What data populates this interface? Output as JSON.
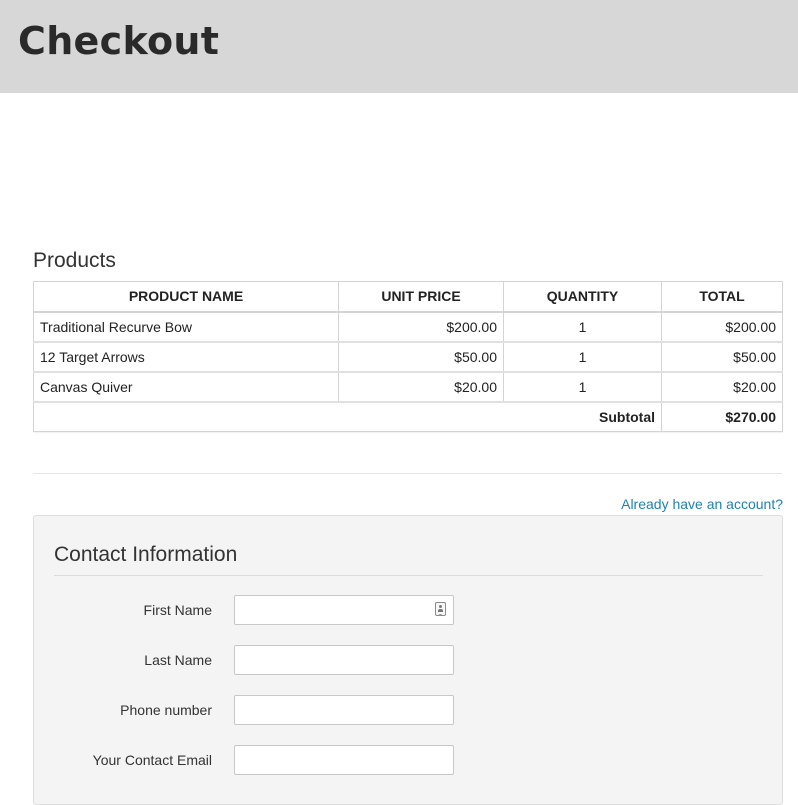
{
  "header": {
    "title": "Checkout"
  },
  "products": {
    "heading": "Products",
    "columns": {
      "name": "PRODUCT NAME",
      "unit_price": "UNIT PRICE",
      "quantity": "QUANTITY",
      "total": "TOTAL"
    },
    "rows": [
      {
        "name": "Traditional Recurve Bow",
        "unit_price": "$200.00",
        "quantity": "1",
        "total": "$200.00"
      },
      {
        "name": "12 Target Arrows",
        "unit_price": "$50.00",
        "quantity": "1",
        "total": "$50.00"
      },
      {
        "name": "Canvas Quiver",
        "unit_price": "$20.00",
        "quantity": "1",
        "total": "$20.00"
      }
    ],
    "subtotal_label": "Subtotal",
    "subtotal_value": "$270.00"
  },
  "account_link": "Already have an account?",
  "contact": {
    "heading": "Contact Information",
    "fields": {
      "first_name": {
        "label": "First Name",
        "value": ""
      },
      "last_name": {
        "label": "Last Name",
        "value": ""
      },
      "phone": {
        "label": "Phone number",
        "value": ""
      },
      "email": {
        "label": "Your Contact Email",
        "value": ""
      }
    },
    "autofill_icon": "contact-card-icon"
  },
  "colors": {
    "header_bg": "#d7d7d7",
    "link": "#1e82b4",
    "panel_bg": "#f4f4f4"
  }
}
